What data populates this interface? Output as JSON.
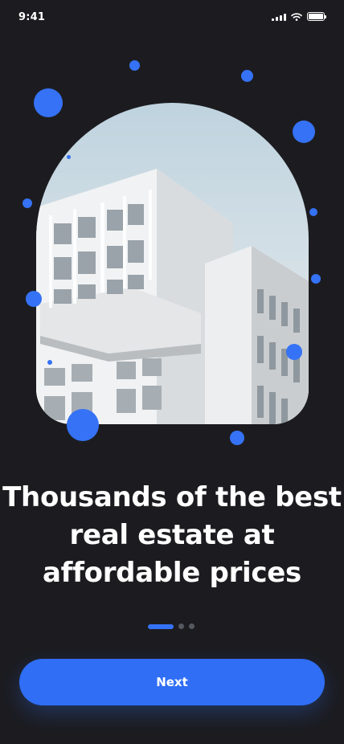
{
  "status_bar": {
    "time": "9:41"
  },
  "onboarding": {
    "headline": "Thousands of the best real estate at affordable prices",
    "page_index": 1,
    "page_count": 3,
    "next_label": "Next"
  },
  "colors": {
    "background": "#1c1c20",
    "accent": "#2f6ef5",
    "text": "#ffffff",
    "inactive_dot": "#555860"
  },
  "icons": [
    "signal-icon",
    "wifi-icon",
    "battery-icon"
  ]
}
